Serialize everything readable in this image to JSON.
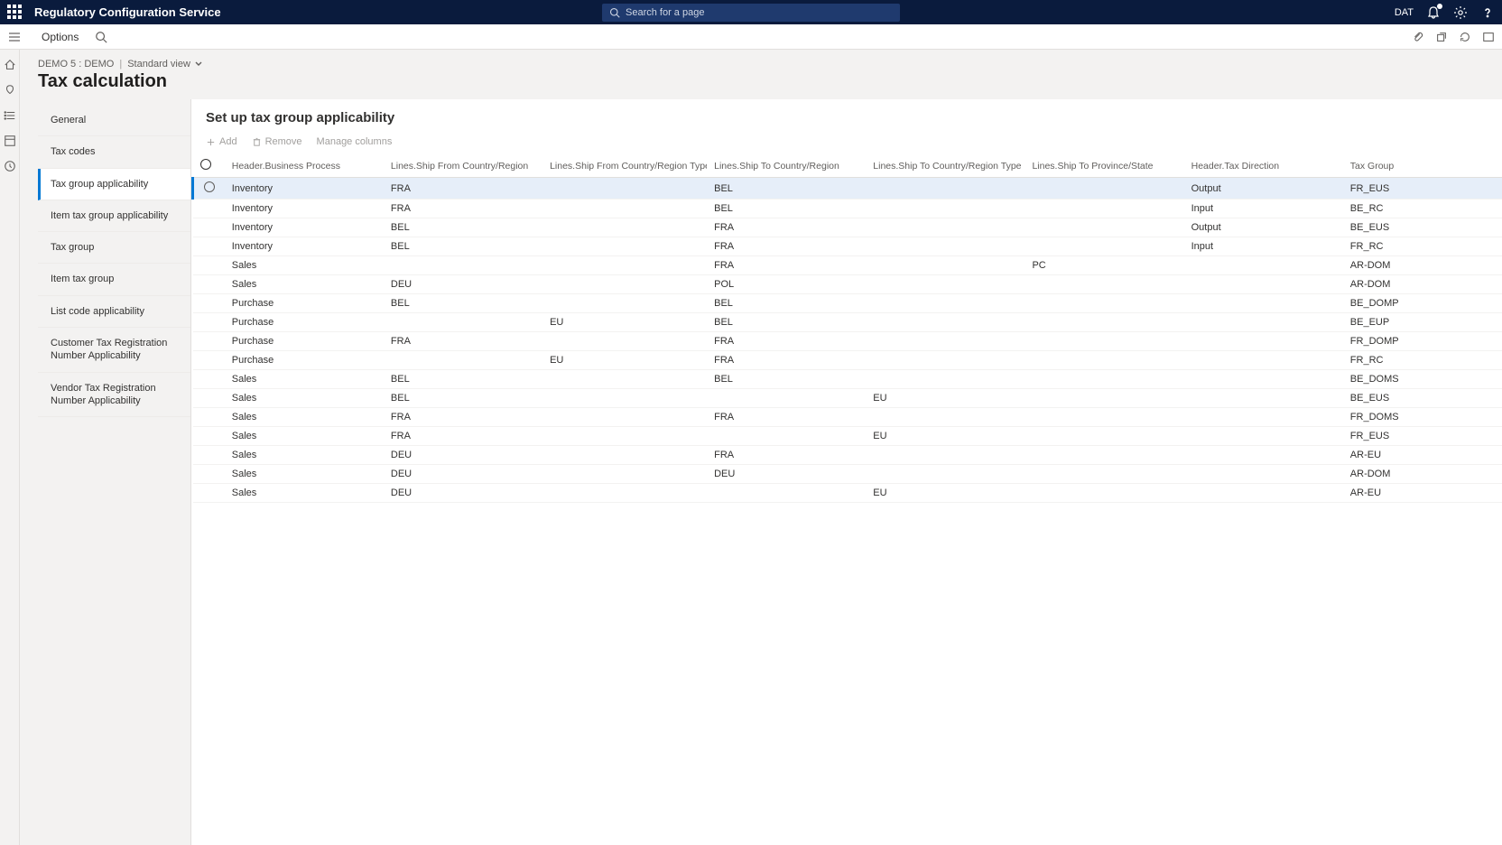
{
  "header": {
    "app_title": "Regulatory Configuration Service",
    "search_placeholder": "Search for a page",
    "company": "DAT"
  },
  "cmdbar": {
    "options": "Options"
  },
  "breadcrumb": {
    "context": "DEMO 5 : DEMO",
    "view": "Standard view"
  },
  "page": {
    "title": "Tax calculation",
    "panel_title": "Set up tax group applicability"
  },
  "sidenav": [
    {
      "label": "General",
      "active": false
    },
    {
      "label": "Tax codes",
      "active": false
    },
    {
      "label": "Tax group applicability",
      "active": true
    },
    {
      "label": "Item tax group applicability",
      "active": false
    },
    {
      "label": "Tax group",
      "active": false
    },
    {
      "label": "Item tax group",
      "active": false
    },
    {
      "label": "List code applicability",
      "active": false
    },
    {
      "label": "Customer Tax Registration Number Applicability",
      "active": false
    },
    {
      "label": "Vendor Tax Registration Number Applicability",
      "active": false
    }
  ],
  "toolbar": {
    "add": "Add",
    "remove": "Remove",
    "manage": "Manage columns"
  },
  "columns": [
    "Header.Business Process",
    "Lines.Ship From Country/Region",
    "Lines.Ship From Country/Region Type",
    "Lines.Ship To Country/Region",
    "Lines.Ship To Country/Region Type",
    "Lines.Ship To Province/State",
    "Header.Tax Direction",
    "Tax Group"
  ],
  "rows": [
    {
      "bp": "Inventory",
      "from": "FRA",
      "fromType": "",
      "to": "BEL",
      "toType": "",
      "prov": "",
      "dir": "Output",
      "group": "FR_EUS",
      "selected": true
    },
    {
      "bp": "Inventory",
      "from": "FRA",
      "fromType": "",
      "to": "BEL",
      "toType": "",
      "prov": "",
      "dir": "Input",
      "group": "BE_RC"
    },
    {
      "bp": "Inventory",
      "from": "BEL",
      "fromType": "",
      "to": "FRA",
      "toType": "",
      "prov": "",
      "dir": "Output",
      "group": "BE_EUS"
    },
    {
      "bp": "Inventory",
      "from": "BEL",
      "fromType": "",
      "to": "FRA",
      "toType": "",
      "prov": "",
      "dir": "Input",
      "group": "FR_RC"
    },
    {
      "bp": "Sales",
      "from": "",
      "fromType": "",
      "to": "FRA",
      "toType": "",
      "prov": "PC",
      "dir": "",
      "group": "AR-DOM"
    },
    {
      "bp": "Sales",
      "from": "DEU",
      "fromType": "",
      "to": "POL",
      "toType": "",
      "prov": "",
      "dir": "",
      "group": "AR-DOM"
    },
    {
      "bp": "Purchase",
      "from": "BEL",
      "fromType": "",
      "to": "BEL",
      "toType": "",
      "prov": "",
      "dir": "",
      "group": "BE_DOMP"
    },
    {
      "bp": "Purchase",
      "from": "",
      "fromType": "EU",
      "to": "BEL",
      "toType": "",
      "prov": "",
      "dir": "",
      "group": "BE_EUP"
    },
    {
      "bp": "Purchase",
      "from": "FRA",
      "fromType": "",
      "to": "FRA",
      "toType": "",
      "prov": "",
      "dir": "",
      "group": "FR_DOMP"
    },
    {
      "bp": "Purchase",
      "from": "",
      "fromType": "EU",
      "to": "FRA",
      "toType": "",
      "prov": "",
      "dir": "",
      "group": "FR_RC"
    },
    {
      "bp": "Sales",
      "from": "BEL",
      "fromType": "",
      "to": "BEL",
      "toType": "",
      "prov": "",
      "dir": "",
      "group": "BE_DOMS"
    },
    {
      "bp": "Sales",
      "from": "BEL",
      "fromType": "",
      "to": "",
      "toType": "EU",
      "prov": "",
      "dir": "",
      "group": "BE_EUS"
    },
    {
      "bp": "Sales",
      "from": "FRA",
      "fromType": "",
      "to": "FRA",
      "toType": "",
      "prov": "",
      "dir": "",
      "group": "FR_DOMS"
    },
    {
      "bp": "Sales",
      "from": "FRA",
      "fromType": "",
      "to": "",
      "toType": "EU",
      "prov": "",
      "dir": "",
      "group": "FR_EUS"
    },
    {
      "bp": "Sales",
      "from": "DEU",
      "fromType": "",
      "to": "FRA",
      "toType": "",
      "prov": "",
      "dir": "",
      "group": "AR-EU"
    },
    {
      "bp": "Sales",
      "from": "DEU",
      "fromType": "",
      "to": "DEU",
      "toType": "",
      "prov": "",
      "dir": "",
      "group": "AR-DOM"
    },
    {
      "bp": "Sales",
      "from": "DEU",
      "fromType": "",
      "to": "",
      "toType": "EU",
      "prov": "",
      "dir": "",
      "group": "AR-EU"
    }
  ]
}
